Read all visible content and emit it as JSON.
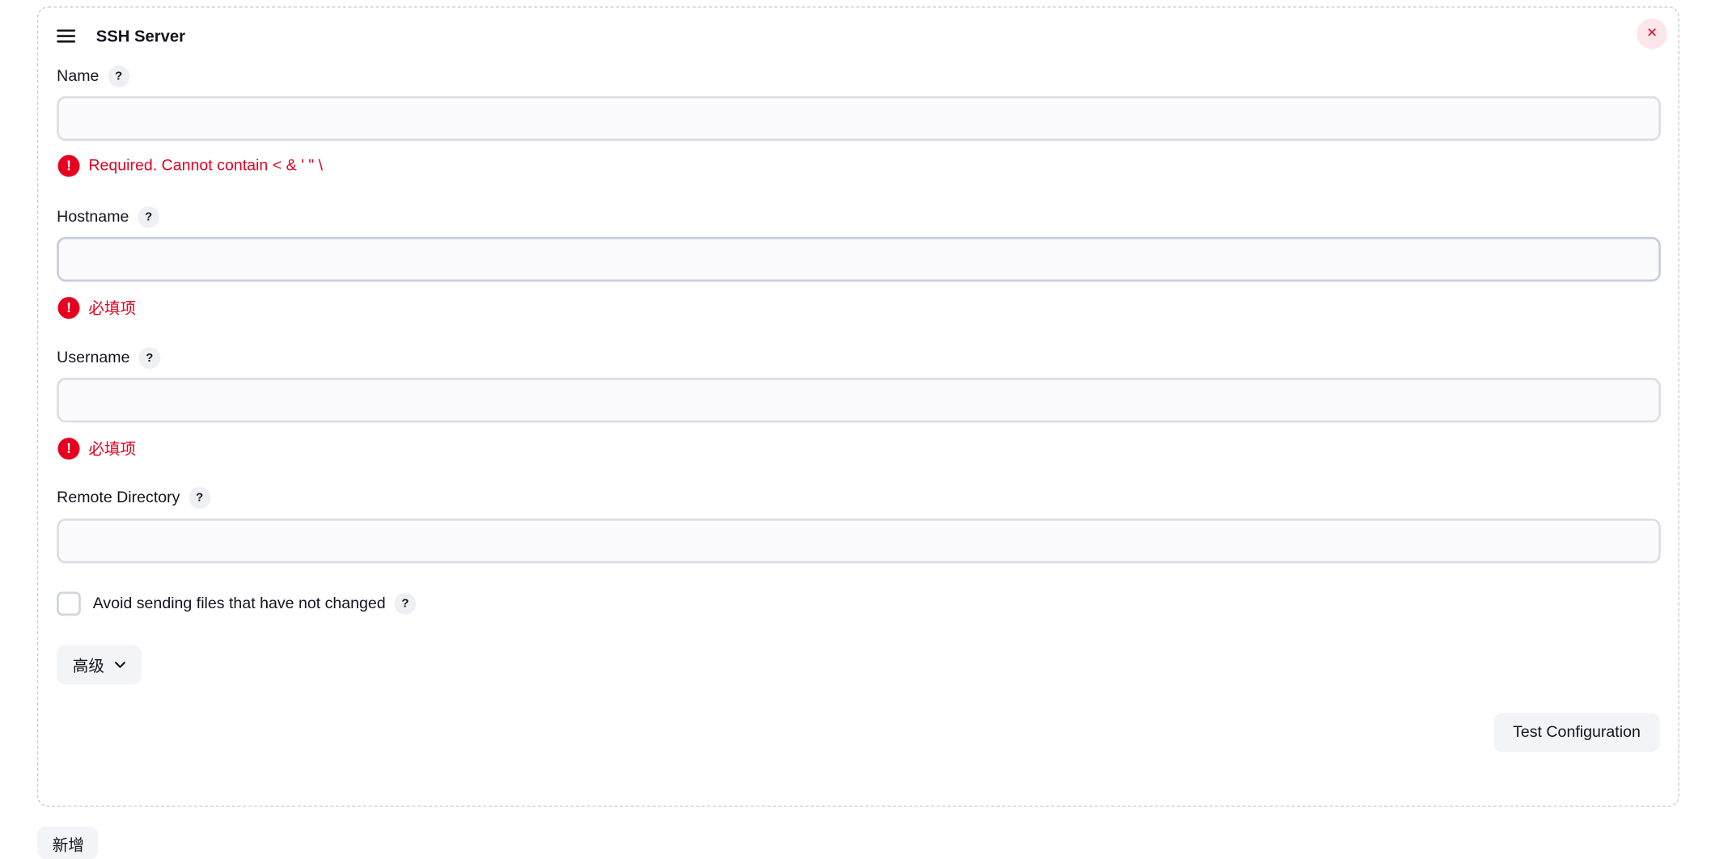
{
  "panel": {
    "title": "SSH Server",
    "close_symbol": "×",
    "icons": {
      "drag": "drag-handle-icon",
      "close": "close-icon",
      "help": "help-icon",
      "error": "error-icon",
      "chevron": "chevron-down-icon"
    }
  },
  "fields": {
    "name": {
      "label": "Name",
      "value": "",
      "error": "Required. Cannot contain < & ' \" \\"
    },
    "hostname": {
      "label": "Hostname",
      "value": "",
      "error": "必填项"
    },
    "username": {
      "label": "Username",
      "value": "",
      "error": "必填项"
    },
    "remote_directory": {
      "label": "Remote Directory",
      "value": ""
    }
  },
  "help_symbol": "?",
  "error_symbol": "!",
  "checkbox": {
    "label": "Avoid sending files that have not changed",
    "checked": false
  },
  "buttons": {
    "advanced": "高级",
    "test_configuration": "Test Configuration",
    "add": "新增"
  },
  "colors": {
    "error": "#e6001f",
    "close_bg": "#fde6ea",
    "button_bg": "#f3f4f7"
  }
}
